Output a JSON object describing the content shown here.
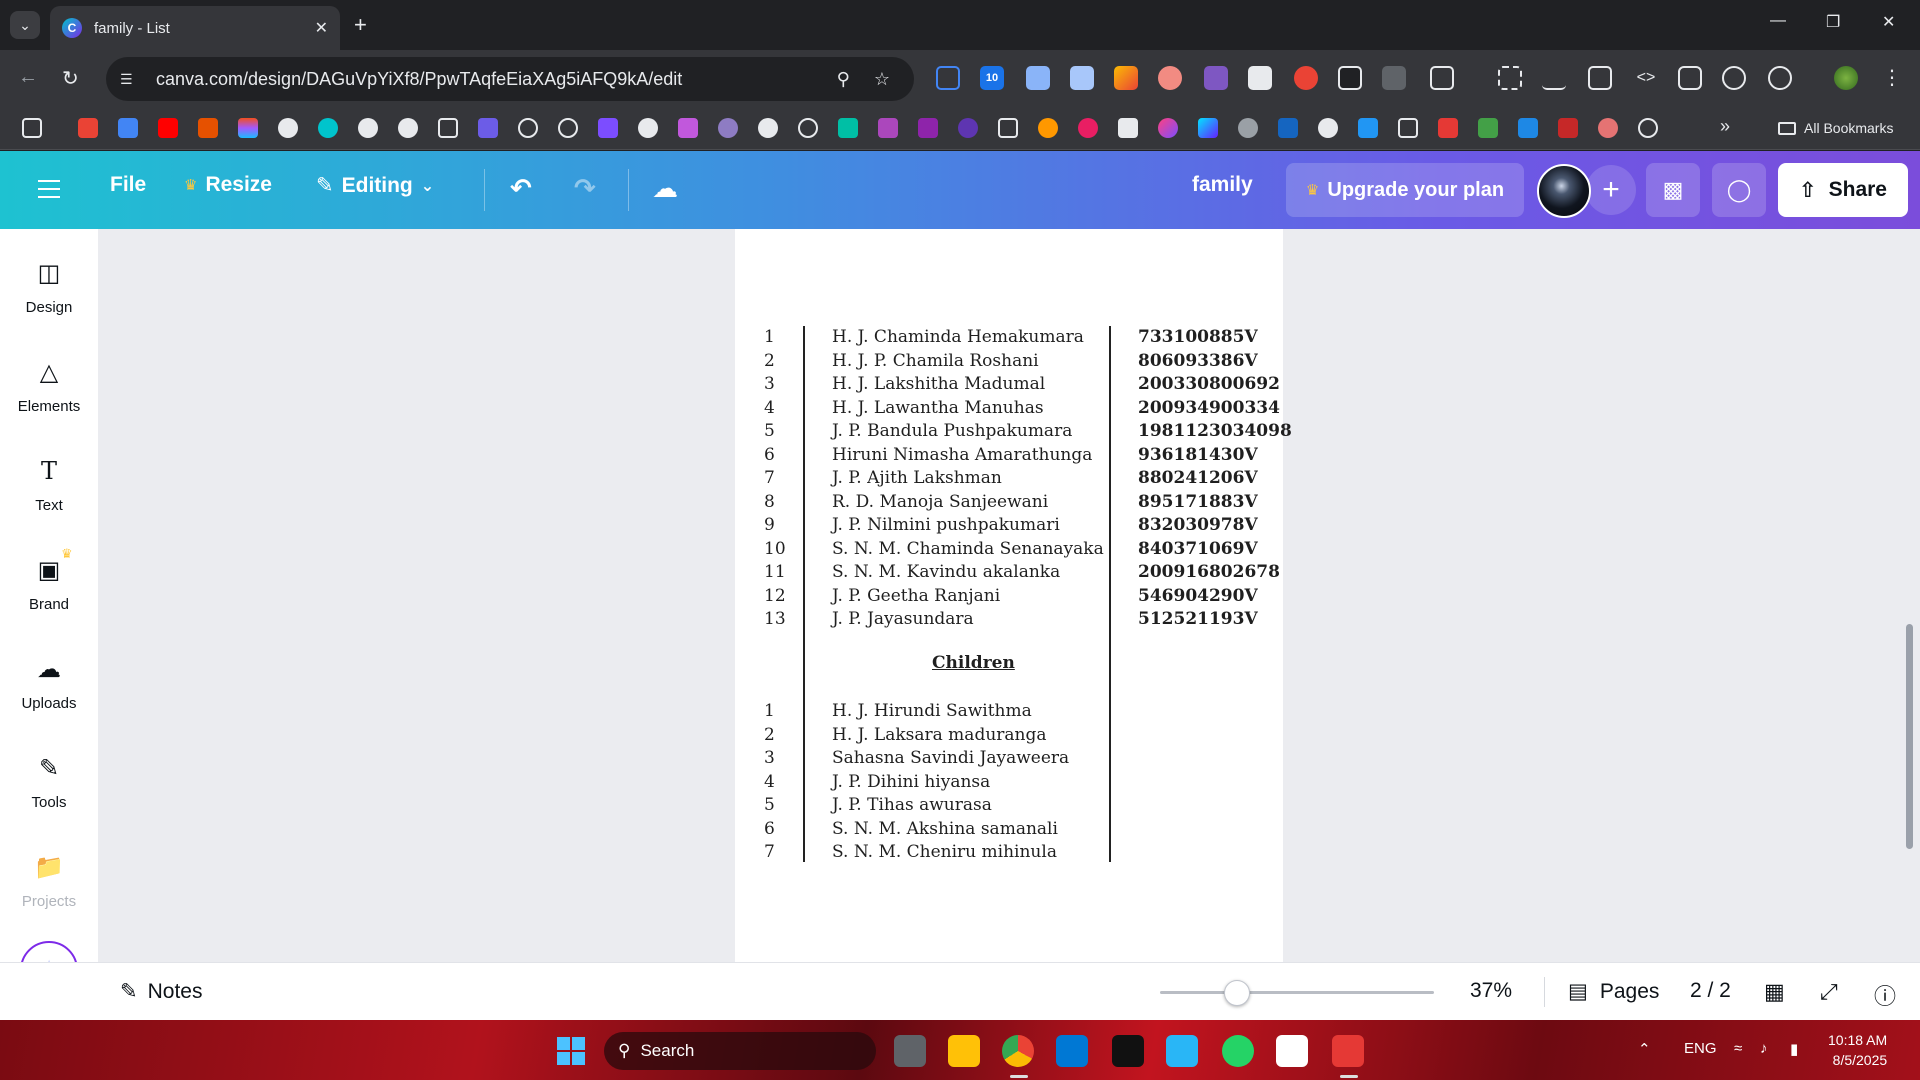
{
  "browser": {
    "tab_title": "family - List",
    "tab_favicon_letter": "C",
    "url": "canva.com/design/DAGuVpYiXf8/PpwTAqfeEiaXAg5iAFQ9kA/edit",
    "extension_badge": "10",
    "all_bookmarks_label": "All Bookmarks"
  },
  "canva": {
    "menu": {
      "file_label": "File",
      "resize_label": "Resize",
      "editing_label": "Editing"
    },
    "design_title": "family",
    "upgrade_label": "Upgrade your plan",
    "share_label": "Share",
    "sidebar": [
      {
        "label": "Design",
        "icon": "design-icon"
      },
      {
        "label": "Elements",
        "icon": "elements-icon"
      },
      {
        "label": "Text",
        "icon": "text-icon"
      },
      {
        "label": "Brand",
        "icon": "brand-icon"
      },
      {
        "label": "Uploads",
        "icon": "uploads-icon"
      },
      {
        "label": "Tools",
        "icon": "tools-icon"
      },
      {
        "label": "Projects",
        "icon": "projects-icon"
      }
    ],
    "footer": {
      "notes_label": "Notes",
      "zoom_level": "37%",
      "zoom_fraction": 0.28,
      "pages_label": "Pages",
      "page_count": "2 / 2"
    }
  },
  "document": {
    "adults": [
      {
        "num": "1",
        "name": "H. J. Chaminda Hemakumara",
        "id": "733100885V"
      },
      {
        "num": "2",
        "name": "H. J. P. Chamila Roshani",
        "id": "806093386V"
      },
      {
        "num": "3",
        "name": "H. J. Lakshitha Madumal",
        "id": "200330800692"
      },
      {
        "num": "4",
        "name": "H. J. Lawantha Manuhas",
        "id": "200934900334"
      },
      {
        "num": "5",
        "name": "J. P. Bandula Pushpakumara",
        "id": "1981123034098"
      },
      {
        "num": "6",
        "name": "Hiruni Nimasha Amarathunga",
        "id": "936181430V"
      },
      {
        "num": "7",
        "name": "J. P. Ajith Lakshman",
        "id": "880241206V"
      },
      {
        "num": "8",
        "name": "R. D. Manoja Sanjeewani",
        "id": "895171883V"
      },
      {
        "num": "9",
        "name": "J. P. Nilmini pushpakumari",
        "id": "832030978V"
      },
      {
        "num": "10",
        "name": "S. N. M. Chaminda Senanayaka",
        "id": "840371069V"
      },
      {
        "num": "11",
        "name": "S. N. M. Kavindu akalanka",
        "id": "200916802678"
      },
      {
        "num": "12",
        "name": "J. P. Geetha Ranjani",
        "id": "546904290V"
      },
      {
        "num": "13",
        "name": "J. P. Jayasundara",
        "id": "512521193V"
      }
    ],
    "children_heading": "Children",
    "children": [
      {
        "num": "1",
        "name": "H. J. Hirundi Sawithma"
      },
      {
        "num": "2",
        "name": "H. J. Laksara maduranga"
      },
      {
        "num": "3",
        "name": "Sahasna Savindi Jayaweera"
      },
      {
        "num": "4",
        "name": "J. P. Dihini hiyansa"
      },
      {
        "num": "5",
        "name": "J. P. Tihas awurasa"
      },
      {
        "num": "6",
        "name": "S. N. M. Akshina samanali"
      },
      {
        "num": "7",
        "name": "S. N. M. Cheniru mihinula"
      }
    ]
  },
  "taskbar": {
    "search_label": "Search",
    "language": "ENG",
    "time": "10:18 AM",
    "date": "8/5/2025"
  },
  "colors": {
    "canva_gradient_start": "#1ec2d1",
    "canva_gradient_end": "#7b4ddb",
    "crown": "#ffc83d",
    "taskbar_red": "#b1121c"
  }
}
